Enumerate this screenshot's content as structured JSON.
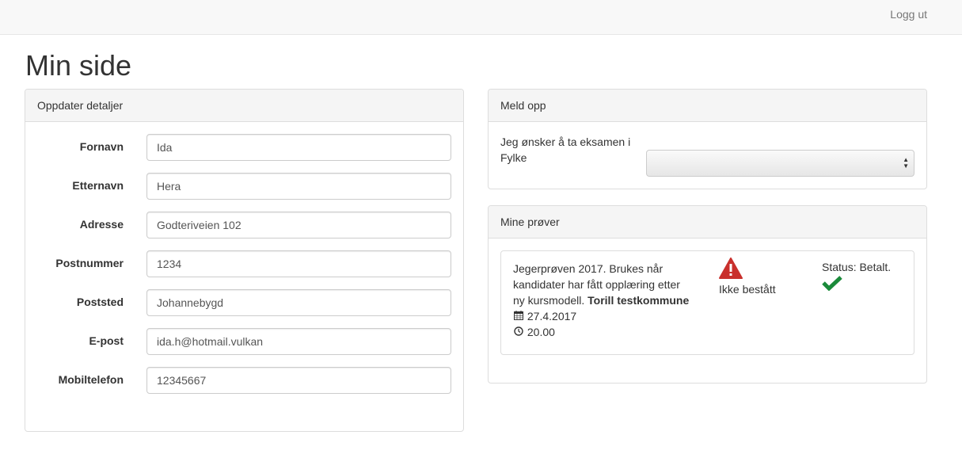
{
  "navbar": {
    "logout_label": "Logg ut"
  },
  "page": {
    "title": "Min side"
  },
  "details": {
    "heading": "Oppdater detaljer",
    "fields": [
      {
        "label": "Fornavn",
        "value": "Ida"
      },
      {
        "label": "Etternavn",
        "value": "Hera"
      },
      {
        "label": "Adresse",
        "value": "Godteriveien 102"
      },
      {
        "label": "Postnummer",
        "value": "1234"
      },
      {
        "label": "Poststed",
        "value": "Johannebygd"
      },
      {
        "label": "E-post",
        "value": "ida.h@hotmail.vulkan"
      },
      {
        "label": "Mobiltelefon",
        "value": "12345667"
      }
    ]
  },
  "signup": {
    "heading": "Meld opp",
    "prompt_line1": "Jeg ønsker å ta eksamen i",
    "prompt_line2": "Fylke",
    "select_value": ""
  },
  "tests": {
    "heading": "Mine prøver",
    "items": [
      {
        "desc_line1": "Jegerprøven 2017. Brukes når",
        "desc_line2": "kandidater har fått opplæring etter",
        "desc_line3": "ny kursmodell.",
        "municipality": "Torill testkommune",
        "date": "27.4.2017",
        "time": "20.00",
        "result": "Ikke bestått",
        "status": "Status: Betalt.",
        "warning_color": "#c9302c",
        "check_color": "#1a8a3a"
      }
    ]
  },
  "icons": {
    "calendar": "calendar-icon",
    "clock": "clock-icon",
    "warning": "warning-icon",
    "check": "check-icon"
  }
}
